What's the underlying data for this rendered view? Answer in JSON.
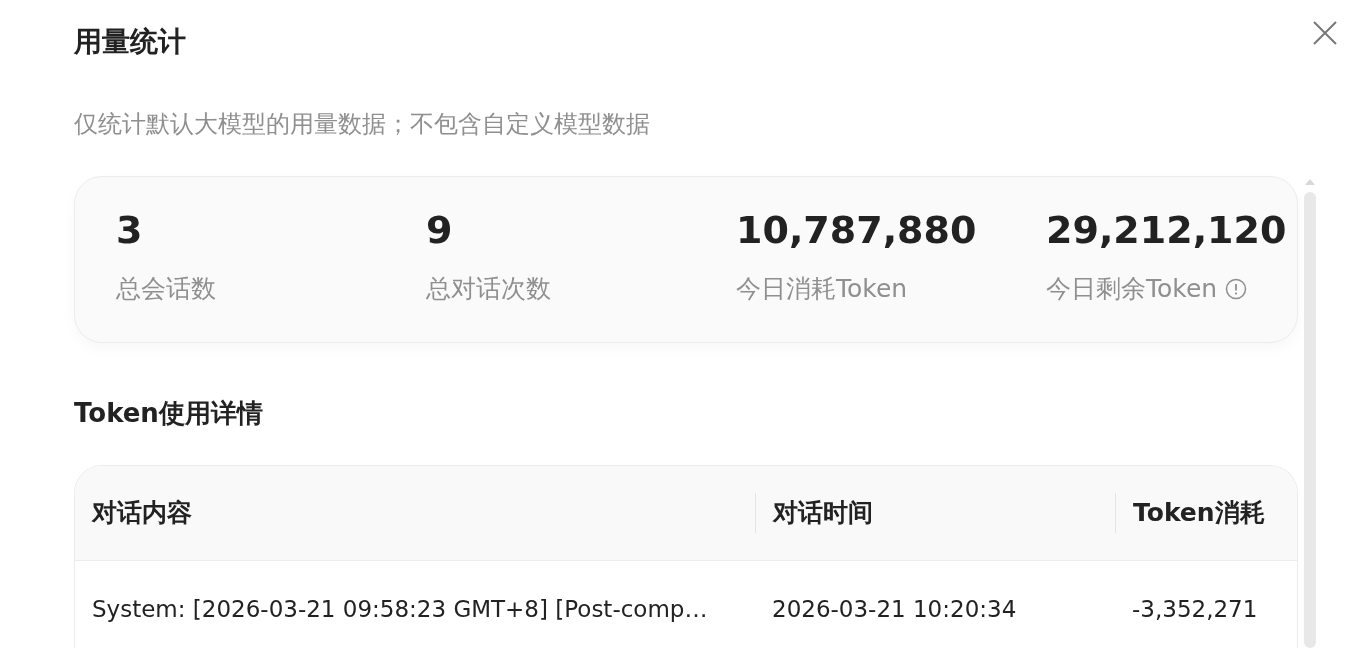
{
  "dialog": {
    "title": "用量统计",
    "subtitle": "仅统计默认大模型的用量数据；不包含自定义模型数据"
  },
  "stats": [
    {
      "value": "3",
      "label": "总会话数",
      "info": false
    },
    {
      "value": "9",
      "label": "总对话次数",
      "info": false
    },
    {
      "value": "10,787,880",
      "label": "今日消耗Token",
      "info": false
    },
    {
      "value": "29,212,120",
      "label": "今日剩余Token",
      "info": true
    }
  ],
  "details": {
    "heading": "Token使用详情",
    "columns": [
      "对话内容",
      "对话时间",
      "Token消耗"
    ],
    "rows": [
      [
        "System: [2026-03-21 09:58:23 GMT+8] [Post-comp…",
        "2026-03-21 10:20:34",
        "-3,352,271"
      ]
    ]
  }
}
